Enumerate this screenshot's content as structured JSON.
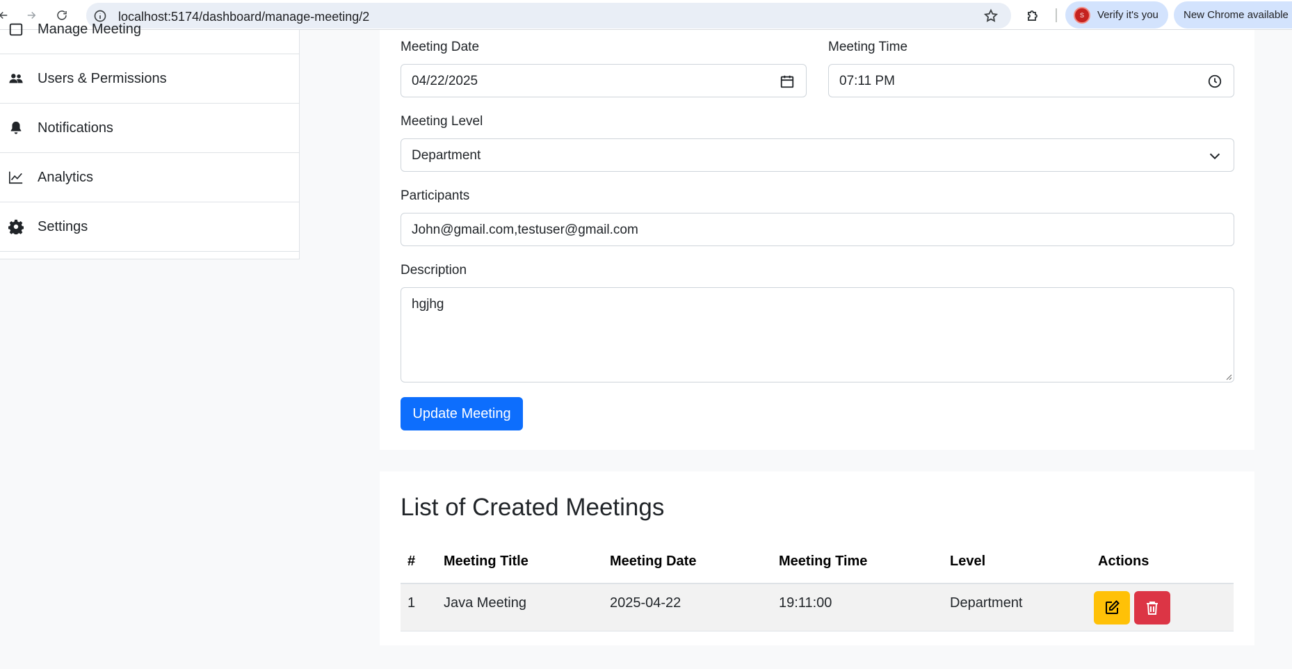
{
  "browser": {
    "url": "localhost:5174/dashboard/manage-meeting/2",
    "verify_label": "Verify it's you",
    "chrome_update_label": "New Chrome available",
    "avatar_letter": "S"
  },
  "sidebar": {
    "items": [
      {
        "label": "Manage Meeting",
        "icon": "calendar-icon"
      },
      {
        "label": "Users & Permissions",
        "icon": "users-icon"
      },
      {
        "label": "Notifications",
        "icon": "bell-icon"
      },
      {
        "label": "Analytics",
        "icon": "chart-line-icon"
      },
      {
        "label": "Settings",
        "icon": "gear-icon"
      }
    ]
  },
  "form": {
    "date_label": "Meeting Date",
    "date_value": "04/22/2025",
    "time_label": "Meeting Time",
    "time_value": "07:11 PM",
    "level_label": "Meeting Level",
    "level_value": "Department",
    "participants_label": "Participants",
    "participants_value": "John@gmail.com,testuser@gmail.com",
    "description_label": "Description",
    "description_value": "hgjhg",
    "submit_label": "Update Meeting"
  },
  "meetings": {
    "title": "List of Created Meetings",
    "columns": [
      "#",
      "Meeting Title",
      "Meeting Date",
      "Meeting Time",
      "Level",
      "Actions"
    ],
    "rows": [
      {
        "num": "1",
        "title": "Java Meeting",
        "date": "2025-04-22",
        "time": "19:11:00",
        "level": "Department"
      }
    ]
  },
  "colors": {
    "primary": "#0d6efd",
    "warning": "#ffc107",
    "danger": "#dc3545"
  }
}
